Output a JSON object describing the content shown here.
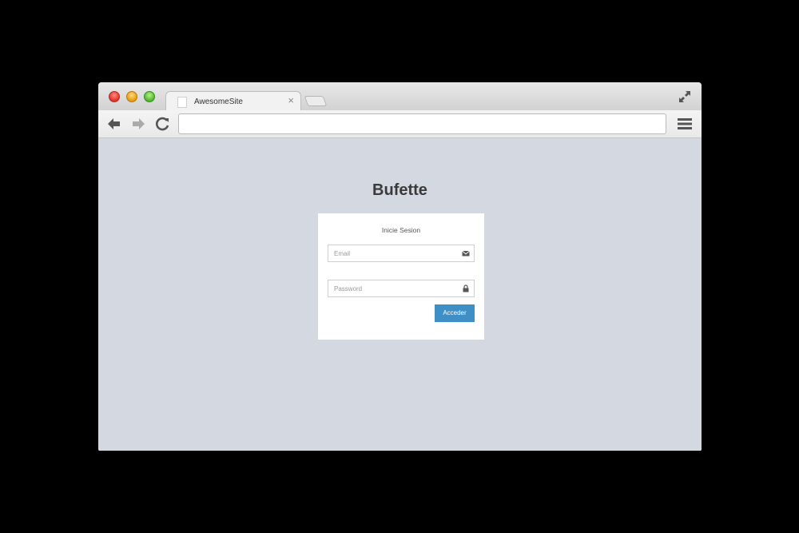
{
  "browser": {
    "tab": {
      "title": "AwesomeSite",
      "close_glyph": "×"
    },
    "address_bar": {
      "value": ""
    },
    "icons": [
      "close-traffic",
      "minimize-traffic",
      "maximize-traffic",
      "fullscreen-icon",
      "back-arrow-icon",
      "forward-arrow-icon",
      "reload-icon",
      "hamburger-menu-icon"
    ]
  },
  "page": {
    "brand": "Bufette",
    "login": {
      "title": "Inicie Sesion",
      "email_placeholder": "Email",
      "password_placeholder": "Password",
      "submit_label": "Acceder"
    },
    "colors": {
      "background": "#d4d8e1",
      "button": "#3d8fc6"
    }
  }
}
